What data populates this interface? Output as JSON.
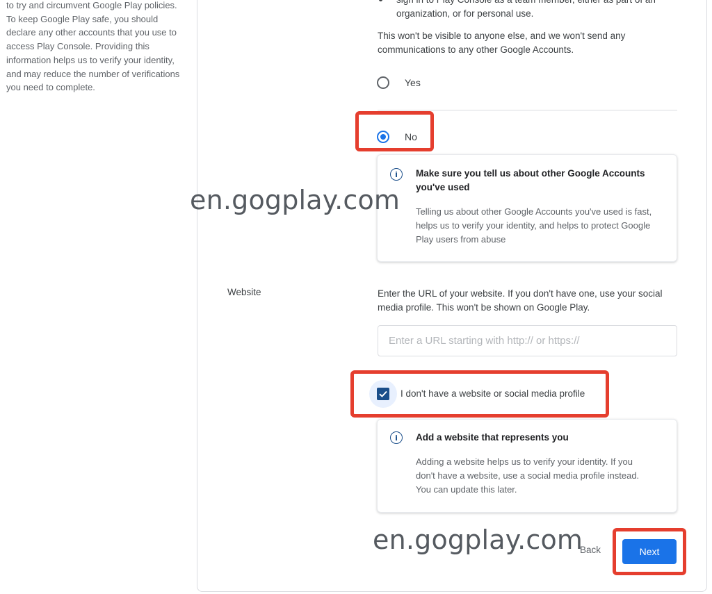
{
  "left_panel": {
    "description": "to try and circumvent Google Play policies. To keep Google Play safe, you should declare any other accounts that you use to access Play Console. Providing this information helps us to verify your identity, and may reduce the number of verifications you need to complete."
  },
  "other_accounts": {
    "bullet_text": "sign in to Play Console as a team member, either as part of an organization, or for personal use.",
    "note": "This won't be visible to anyone else, and we won't send any communications to any other Google Accounts.",
    "options": [
      {
        "label": "Yes",
        "selected": false
      },
      {
        "label": "No",
        "selected": true
      }
    ],
    "info": {
      "title": "Make sure you tell us about other Google Accounts you've used",
      "body": "Telling us about other Google Accounts you've used is fast, helps us to verify your identity, and helps to protect Google Play users from abuse"
    }
  },
  "website": {
    "label": "Website",
    "help": "Enter the URL of your website. If you don't have one, use your social media profile. This won't be shown on Google Play.",
    "input_value": "",
    "input_placeholder": "Enter a URL starting with http:// or https://",
    "no_website_label": "I don't have a website or social media profile",
    "no_website_checked": true,
    "info": {
      "title": "Add a website that represents you",
      "body": "Adding a website helps us to verify your identity. If you don't have a website, use a social media profile instead. You can update this later."
    }
  },
  "actions": {
    "back_label": "Back",
    "next_label": "Next"
  },
  "watermarks": [
    "en.gogplay.com",
    "en.gogplay.com"
  ],
  "colors": {
    "accent": "#1a73e8",
    "checkbox": "#1a4e8a",
    "highlight": "#e53e2e"
  }
}
